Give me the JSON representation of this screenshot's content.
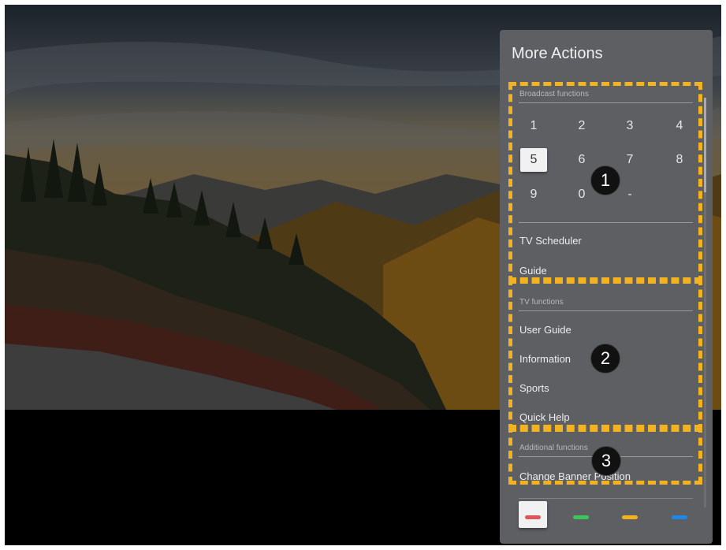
{
  "panel": {
    "title": "More Actions",
    "broadcast": {
      "label": "Broadcast functions",
      "numbers": [
        "1",
        "2",
        "3",
        "4",
        "5",
        "6",
        "7",
        "8",
        "9",
        "0",
        "-"
      ],
      "selected": "5",
      "items": [
        "TV Scheduler",
        "Guide"
      ]
    },
    "tv": {
      "label": "TV functions",
      "items": [
        "User Guide",
        "Information",
        "Sports",
        "Quick Help"
      ]
    },
    "additional": {
      "label": "Additional functions",
      "items": [
        "Change Banner Position"
      ]
    },
    "color_keys": [
      {
        "name": "red-key",
        "color": "#e0555a"
      },
      {
        "name": "green-key",
        "color": "#3cc65a"
      },
      {
        "name": "yellow-key",
        "color": "#f0b21d"
      },
      {
        "name": "blue-key",
        "color": "#1e88e5"
      }
    ]
  },
  "callouts": [
    "1",
    "2",
    "3"
  ],
  "highlight_color": "#f3b21f"
}
